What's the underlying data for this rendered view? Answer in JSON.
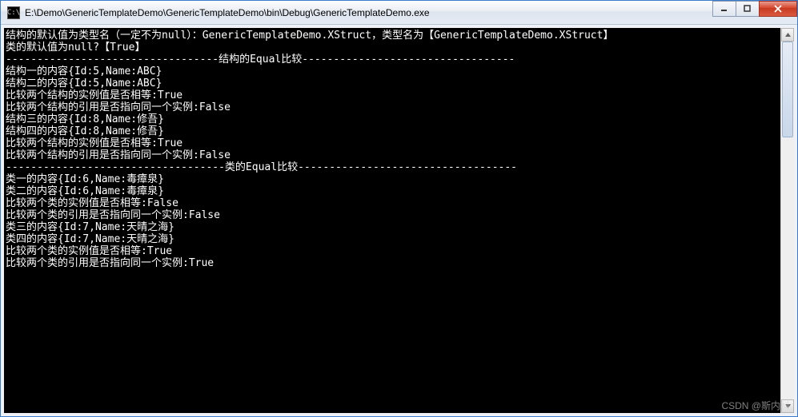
{
  "window": {
    "title": "E:\\Demo\\GenericTemplateDemo\\GenericTemplateDemo\\bin\\Debug\\GenericTemplateDemo.exe",
    "icon_glyph": "C:\\"
  },
  "controls": {
    "minimize_label": "min",
    "maximize_label": "max",
    "close_label": "×"
  },
  "console": {
    "lines": [
      "结构的默认值为类型名（一定不为null）：GenericTemplateDemo.XStruct，类型名为【GenericTemplateDemo.XStruct】",
      "类的默认值为null?【True】",
      "----------------------------------结构的Equal比较----------------------------------",
      "结构一的内容{Id:5,Name:ABC}",
      "结构二的内容{Id:5,Name:ABC}",
      "",
      "比较两个结构的实例值是否相等:True",
      "比较两个结构的引用是否指向同一个实例:False",
      "结构三的内容{Id:8,Name:修吾}",
      "结构四的内容{Id:8,Name:修吾}",
      "",
      "比较两个结构的实例值是否相等:True",
      "比较两个结构的引用是否指向同一个实例:False",
      "-----------------------------------类的Equal比较-----------------------------------",
      "类一的内容{Id:6,Name:毒瘴泉}",
      "类二的内容{Id:6,Name:毒瘴泉}",
      "",
      "比较两个类的实例值是否相等:False",
      "比较两个类的引用是否指向同一个实例:False",
      "",
      "类三的内容{Id:7,Name:天晴之海}",
      "类四的内容{Id:7,Name:天晴之海}",
      "",
      "比较两个类的实例值是否相等:True",
      "比较两个类的引用是否指向同一个实例:True"
    ]
  },
  "watermark": "CSDN @斯内科"
}
